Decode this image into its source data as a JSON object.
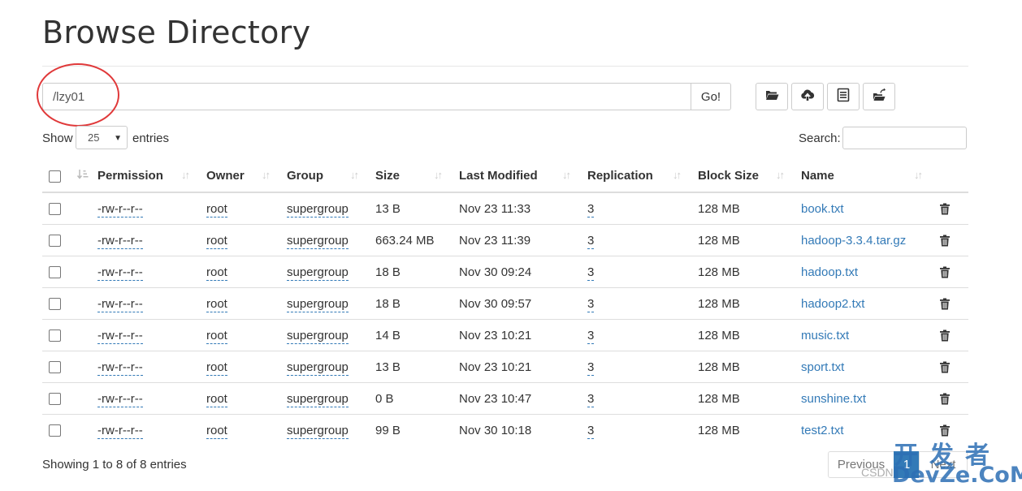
{
  "page": {
    "title": "Browse Directory"
  },
  "path_bar": {
    "value": "/lzy01",
    "go_label": "Go!"
  },
  "toolbar": {
    "icons": [
      "folder-open-icon",
      "upload-cloud-icon",
      "list-alt-icon",
      "folder-share-icon"
    ]
  },
  "length": {
    "show_label": "Show",
    "selected": "25",
    "entries_label": "entries"
  },
  "search": {
    "label": "Search:",
    "value": ""
  },
  "table": {
    "headers": [
      "Permission",
      "Owner",
      "Group",
      "Size",
      "Last Modified",
      "Replication",
      "Block Size",
      "Name"
    ],
    "rows": [
      {
        "permission": "-rw-r--r--",
        "owner": "root",
        "group": "supergroup",
        "size": "13 B",
        "modified": "Nov 23 11:33",
        "replication": "3",
        "block": "128 MB",
        "name": "book.txt"
      },
      {
        "permission": "-rw-r--r--",
        "owner": "root",
        "group": "supergroup",
        "size": "663.24 MB",
        "modified": "Nov 23 11:39",
        "replication": "3",
        "block": "128 MB",
        "name": "hadoop-3.3.4.tar.gz"
      },
      {
        "permission": "-rw-r--r--",
        "owner": "root",
        "group": "supergroup",
        "size": "18 B",
        "modified": "Nov 30 09:24",
        "replication": "3",
        "block": "128 MB",
        "name": "hadoop.txt"
      },
      {
        "permission": "-rw-r--r--",
        "owner": "root",
        "group": "supergroup",
        "size": "18 B",
        "modified": "Nov 30 09:57",
        "replication": "3",
        "block": "128 MB",
        "name": "hadoop2.txt"
      },
      {
        "permission": "-rw-r--r--",
        "owner": "root",
        "group": "supergroup",
        "size": "14 B",
        "modified": "Nov 23 10:21",
        "replication": "3",
        "block": "128 MB",
        "name": "music.txt"
      },
      {
        "permission": "-rw-r--r--",
        "owner": "root",
        "group": "supergroup",
        "size": "13 B",
        "modified": "Nov 23 10:21",
        "replication": "3",
        "block": "128 MB",
        "name": "sport.txt"
      },
      {
        "permission": "-rw-r--r--",
        "owner": "root",
        "group": "supergroup",
        "size": "0 B",
        "modified": "Nov 23 10:47",
        "replication": "3",
        "block": "128 MB",
        "name": "sunshine.txt"
      },
      {
        "permission": "-rw-r--r--",
        "owner": "root",
        "group": "supergroup",
        "size": "99 B",
        "modified": "Nov 30 10:18",
        "replication": "3",
        "block": "128 MB",
        "name": "test2.txt"
      }
    ]
  },
  "footer": {
    "info": "Showing 1 to 8 of 8 entries",
    "previous_label": "Previous",
    "current_page": "1",
    "next_label": "Next"
  },
  "watermark": {
    "top": "开发者",
    "bottom": "DevZe.CoM",
    "csdn": "CSDN"
  },
  "colors": {
    "link": "#337ab7",
    "annotation_circle": "#e0393a"
  }
}
